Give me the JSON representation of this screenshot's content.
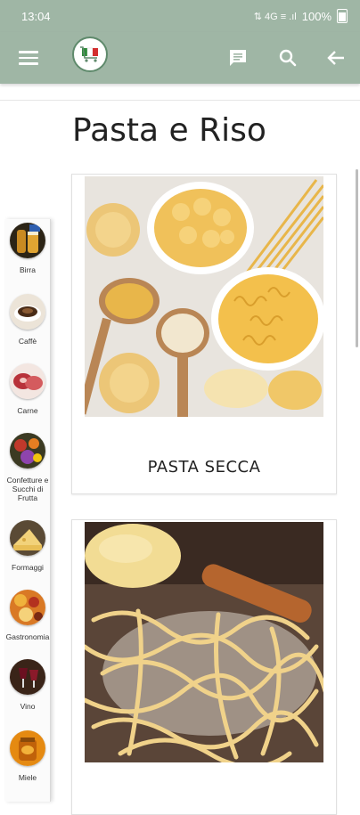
{
  "status_bar": {
    "time": "13:04",
    "indicators": "⇅  4G ≡ .ıl",
    "battery": "100%"
  },
  "app_bar": {
    "menu_icon": "hamburger-menu-icon",
    "logo_icon": "store-cart-logo",
    "chat_icon": "chat-icon",
    "search_icon": "search-icon",
    "back_icon": "arrow-back-icon"
  },
  "page": {
    "title": "Pasta e Riso"
  },
  "sidebar": {
    "items": [
      {
        "label": "Birra"
      },
      {
        "label": "Caffè"
      },
      {
        "label": "Carne"
      },
      {
        "label": "Confetture e Succhi di Frutta"
      },
      {
        "label": "Formaggi"
      },
      {
        "label": "Gastronomia"
      },
      {
        "label": "Vino"
      },
      {
        "label": "Miele"
      }
    ]
  },
  "products": [
    {
      "caption": "PASTA SECCA"
    },
    {
      "caption": ""
    }
  ],
  "colors": {
    "app_bar": "#9fb6a5",
    "logo_ring": "#5f8a6c"
  }
}
